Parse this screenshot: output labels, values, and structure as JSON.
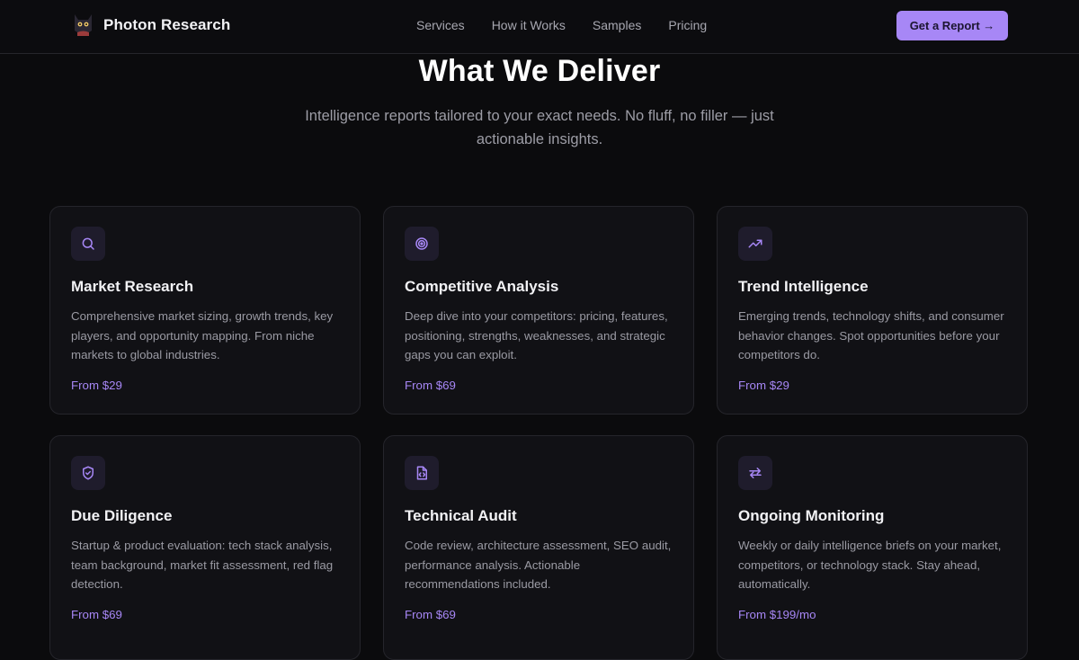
{
  "nav": {
    "brand": "Photon Research",
    "links": [
      "Services",
      "How it Works",
      "Samples",
      "Pricing"
    ],
    "cta": "Get a Report →"
  },
  "hero": {
    "title": "What We Deliver",
    "subtitle": "Intelligence reports tailored to your exact needs. No fluff, no filler — just actionable insights."
  },
  "accent_color": "#a787f6",
  "cards": [
    {
      "icon": "search-icon",
      "title": "Market Research",
      "desc": "Comprehensive market sizing, growth trends, key players, and opportunity mapping. From niche markets to global industries.",
      "price": "From $29"
    },
    {
      "icon": "target-icon",
      "title": "Competitive Analysis",
      "desc": "Deep dive into your competitors: pricing, features, positioning, strengths, weaknesses, and strategic gaps you can exploit.",
      "price": "From $69"
    },
    {
      "icon": "trend-up-icon",
      "title": "Trend Intelligence",
      "desc": "Emerging trends, technology shifts, and consumer behavior changes. Spot opportunities before your competitors do.",
      "price": "From $29"
    },
    {
      "icon": "shield-icon",
      "title": "Due Diligence",
      "desc": "Startup & product evaluation: tech stack analysis, team background, market fit assessment, red flag detection.",
      "price": "From $69"
    },
    {
      "icon": "code-file-icon",
      "title": "Technical Audit",
      "desc": "Code review, architecture assessment, SEO audit, performance analysis. Actionable recommendations included.",
      "price": "From $69"
    },
    {
      "icon": "repeat-icon",
      "title": "Ongoing Monitoring",
      "desc": "Weekly or daily intelligence briefs on your market, competitors, or technology stack. Stay ahead, automatically.",
      "price": "From $199/mo"
    }
  ]
}
